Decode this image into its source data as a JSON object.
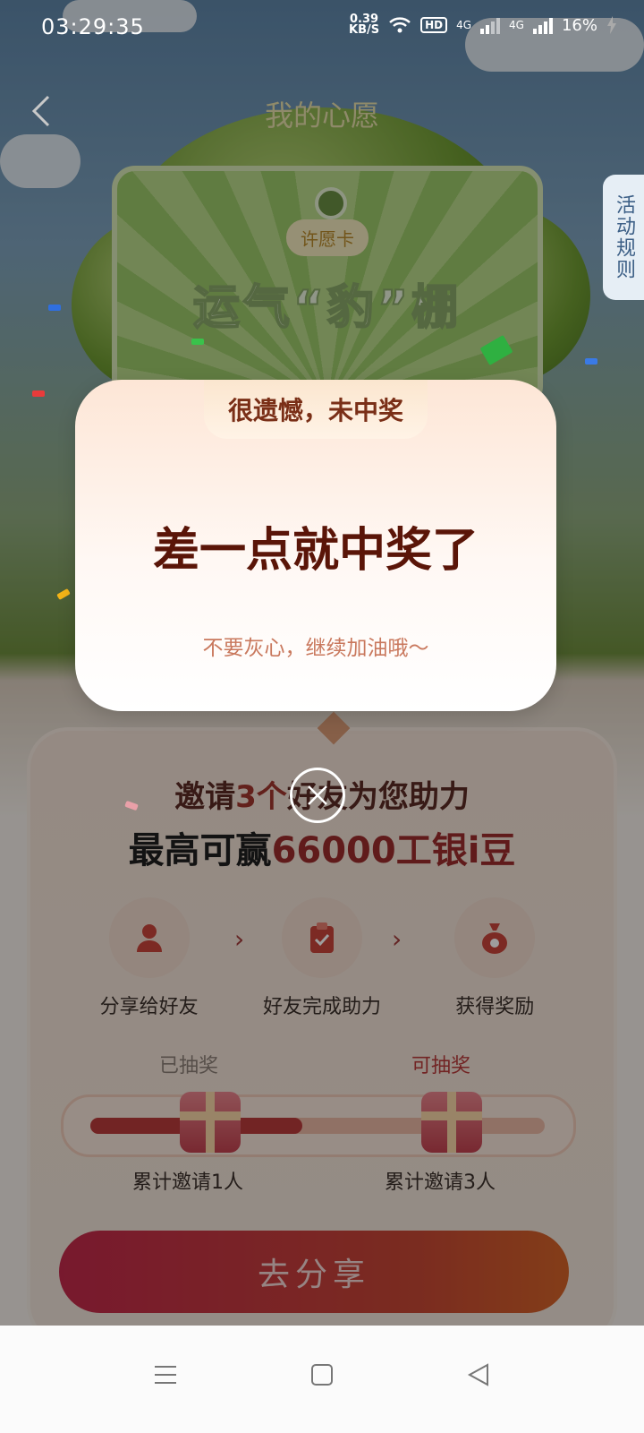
{
  "status_bar": {
    "time": "03:29:35",
    "speed_value": "0.39",
    "speed_unit": "KB/S",
    "hd": "HD",
    "net1": "4G",
    "net2": "4G",
    "battery": "16%"
  },
  "header": {
    "title": "我的心愿",
    "rules_tab": "活动规则"
  },
  "wish_card": {
    "tag": "许愿卡",
    "title": "运气“豹”棚"
  },
  "modal": {
    "tag": "很遗憾，未中奖",
    "title": "差一点就中奖了",
    "subtitle": "不要灰心，继续加油哦～"
  },
  "panel": {
    "invite_prefix": "邀请",
    "invite_count": "3个",
    "invite_suffix": "好友为您助力",
    "win_prefix": "最高可赢",
    "win_amount": "66000工银i豆",
    "steps": [
      {
        "label": "分享给好友",
        "icon": "user-icon"
      },
      {
        "label": "好友完成助力",
        "icon": "clipboard-check-icon"
      },
      {
        "label": "获得奖励",
        "icon": "money-bag-icon"
      }
    ],
    "progress": {
      "left_label": "已抽奖",
      "right_label": "可抽奖",
      "left_sub": "累计邀请1人",
      "right_sub": "累计邀请3人",
      "invited": 1,
      "target": 3
    },
    "share_button": "去分享"
  },
  "colors": {
    "accent_red": "#b93a3a",
    "modal_title": "#5a1508",
    "modal_sub": "#c9785d"
  }
}
